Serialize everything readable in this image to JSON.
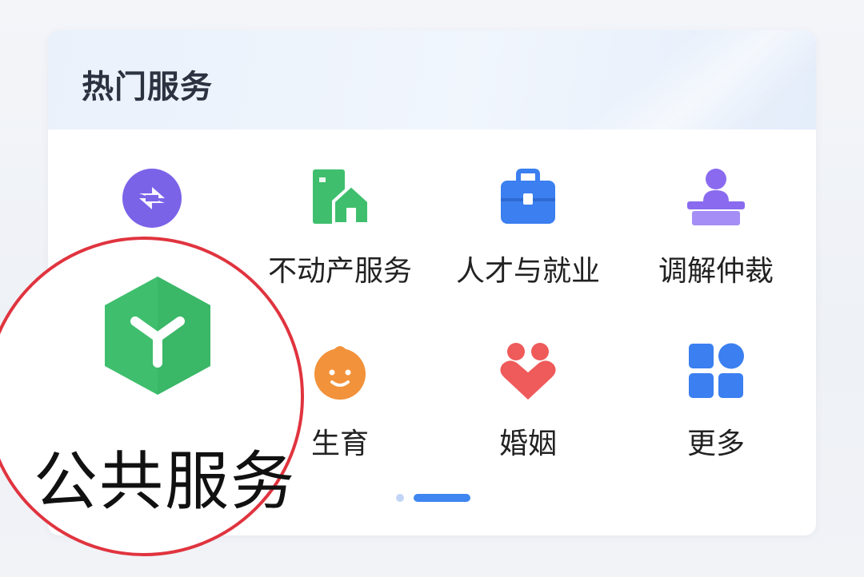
{
  "section": {
    "title": "热门服务"
  },
  "services": [
    {
      "label": "",
      "icon": "globe-exchange-icon",
      "color": "#7b63e8"
    },
    {
      "label": "不动产服务",
      "icon": "real-estate-icon",
      "color": "#3fbf6d"
    },
    {
      "label": "人才与就业",
      "icon": "briefcase-icon",
      "color": "#3b7ff0"
    },
    {
      "label": "调解仲裁",
      "icon": "mediation-icon",
      "color": "#8a6bef"
    },
    {
      "label": "",
      "icon": "",
      "color": ""
    },
    {
      "label": "生育",
      "icon": "baby-face-icon",
      "color": "#f2923a"
    },
    {
      "label": "婚姻",
      "icon": "heart-couple-icon",
      "color": "#ef5a5a"
    },
    {
      "label": "更多",
      "icon": "more-grid-icon",
      "color": "#3b7ff0"
    }
  ],
  "pager": {
    "total": 2,
    "active": 2
  },
  "callout": {
    "label": "公共服务",
    "icon": "public-service-icon",
    "color": "#3fbf6d",
    "ring_color": "#e0343f"
  }
}
